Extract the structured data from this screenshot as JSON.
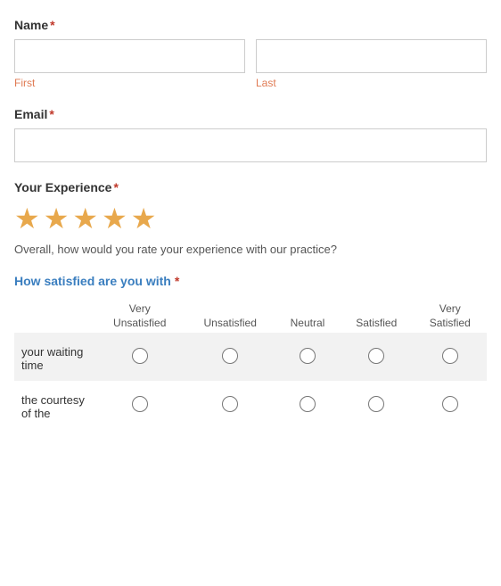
{
  "form": {
    "name_label": "Name",
    "required_mark": "*",
    "first_label": "First",
    "last_label": "Last",
    "email_label": "Email",
    "experience_label": "Your Experience",
    "experience_note": "Overall, how would you rate your experience with our practice?",
    "satisfaction_label": "How satisfied are you with",
    "stars": [
      {
        "filled": true
      },
      {
        "filled": true
      },
      {
        "filled": true
      },
      {
        "filled": true
      },
      {
        "filled": true
      }
    ],
    "satisfaction_columns": [
      {
        "line1": "Very",
        "line2": "Unsatisfied"
      },
      {
        "line1": "",
        "line2": "Unsatisfied"
      },
      {
        "line1": "",
        "line2": "Neutral"
      },
      {
        "line1": "",
        "line2": "Satisfied"
      },
      {
        "line1": "Very",
        "line2": "Satisfied"
      }
    ],
    "satisfaction_rows": [
      {
        "label": "your waiting time"
      },
      {
        "label": "the courtesy of the"
      }
    ]
  }
}
